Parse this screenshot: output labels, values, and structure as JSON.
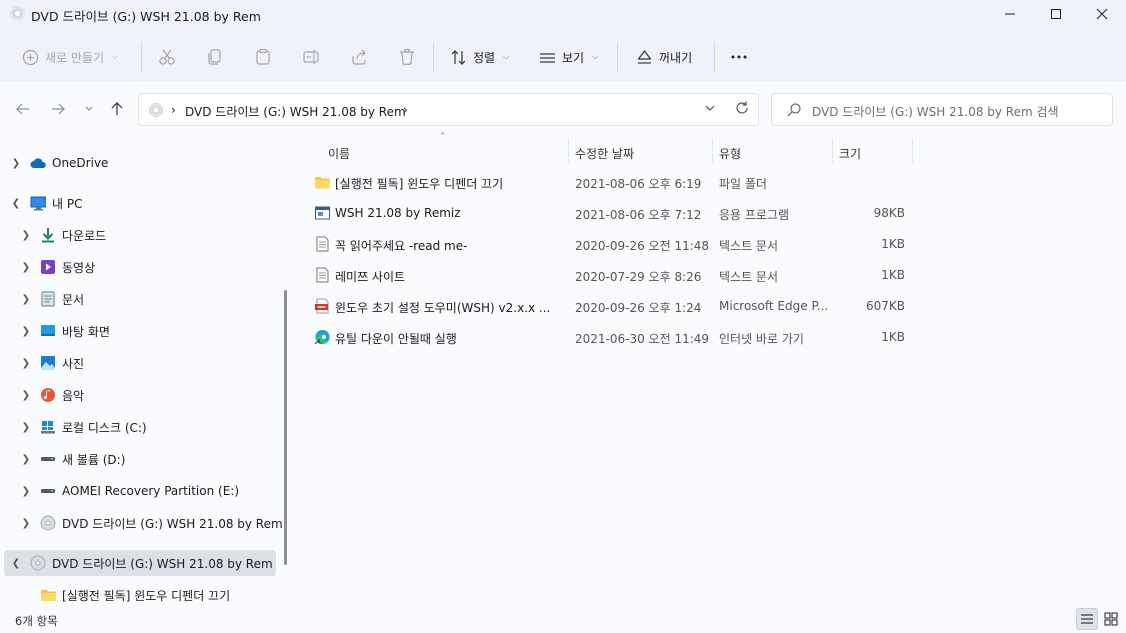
{
  "window": {
    "title": "DVD 드라이브 (G:) WSH 21.08 by Rem"
  },
  "toolbar": {
    "new_label": "새로 만들기",
    "sort_label": "정렬",
    "view_label": "보기",
    "eject_label": "꺼내기"
  },
  "address": {
    "crumb": "DVD 드라이브 (G:) WSH 21.08 by Rem"
  },
  "search": {
    "placeholder": "DVD 드라이브 (G:) WSH 21.08 by Rem 검색"
  },
  "sidebar": {
    "items": [
      {
        "label": "OneDrive",
        "icon": "cloud-icon"
      },
      {
        "label": "내 PC",
        "icon": "computer-icon"
      },
      {
        "label": "다운로드",
        "icon": "download-icon"
      },
      {
        "label": "동영상",
        "icon": "video-icon"
      },
      {
        "label": "문서",
        "icon": "document-icon"
      },
      {
        "label": "바탕 화면",
        "icon": "desktop-icon"
      },
      {
        "label": "사진",
        "icon": "picture-icon"
      },
      {
        "label": "음악",
        "icon": "music-icon"
      },
      {
        "label": "로컬 디스크 (C:)",
        "icon": "windows-drive-icon"
      },
      {
        "label": "새 볼륨 (D:)",
        "icon": "drive-icon"
      },
      {
        "label": "AOMEI Recovery Partition (E:)",
        "icon": "drive-icon"
      },
      {
        "label": "DVD 드라이브 (G:) WSH 21.08 by Rem",
        "icon": "dvd-icon"
      },
      {
        "label": "DVD 드라이브 (G:) WSH 21.08 by Rem",
        "icon": "dvd-icon"
      },
      {
        "label": "[실행전 필독] 윈도우 디펜더 끄기",
        "icon": "folder-icon"
      }
    ]
  },
  "columns": {
    "name": "이름",
    "date": "수정한 날짜",
    "type": "유형",
    "size": "크기"
  },
  "files": [
    {
      "name": "[실행전 필독] 윈도우 디펜더 끄기",
      "date": "2021-08-06 오후 6:19",
      "type": "파일 폴더",
      "size": "",
      "icon": "folder-icon"
    },
    {
      "name": "WSH 21.08 by Remiz",
      "date": "2021-08-06 오후 7:12",
      "type": "응용 프로그램",
      "size": "98KB",
      "icon": "application-icon"
    },
    {
      "name": "꼭 읽어주세요 -read me-",
      "date": "2020-09-26 오전 11:48",
      "type": "텍스트 문서",
      "size": "1KB",
      "icon": "text-file-icon"
    },
    {
      "name": "레미쯔 사이트",
      "date": "2020-07-29 오후 8:26",
      "type": "텍스트 문서",
      "size": "1KB",
      "icon": "text-file-icon"
    },
    {
      "name": "윈도우 초기 설정 도우미(WSH) v2.x.x ...",
      "date": "2020-09-26 오후 1:24",
      "type": "Microsoft Edge P...",
      "size": "607KB",
      "icon": "pdf-icon"
    },
    {
      "name": "유틸 다운이 안될때 실행",
      "date": "2021-06-30 오전 11:49",
      "type": "인터넷 바로 가기",
      "size": "1KB",
      "icon": "edge-icon"
    }
  ],
  "status": {
    "count": "6개 항목"
  }
}
